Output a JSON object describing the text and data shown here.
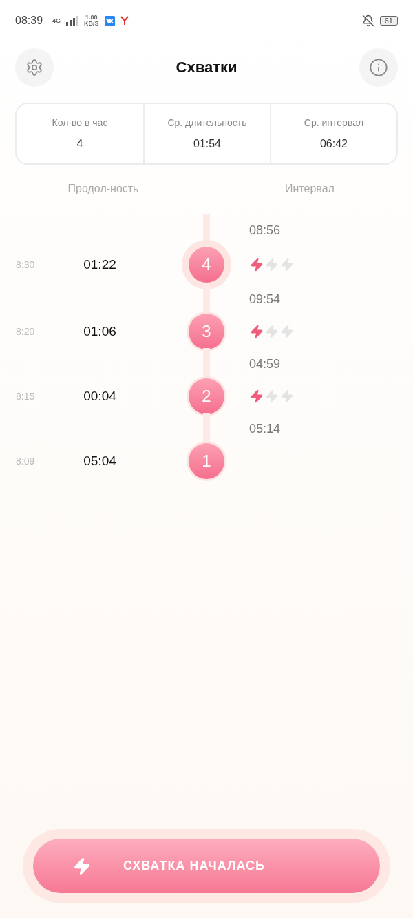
{
  "status_bar": {
    "time": "08:39",
    "network": "4G",
    "speed_value": "1.00",
    "speed_unit": "KB/S",
    "battery": "61"
  },
  "header": {
    "title": "Схватки"
  },
  "stats": [
    {
      "label": "Кол-во в час",
      "value": "4"
    },
    {
      "label": "Ср. длительность",
      "value": "01:54"
    },
    {
      "label": "Ср. интервал",
      "value": "06:42"
    }
  ],
  "columns": {
    "duration": "Продол-ность",
    "interval": "Интервал"
  },
  "contractions": [
    {
      "interval": "08:56",
      "time": "8:30",
      "duration": "01:22",
      "number": "4",
      "stars": 1,
      "selected": true
    },
    {
      "interval": "09:54",
      "time": "8:20",
      "duration": "01:06",
      "number": "3",
      "stars": 1,
      "selected": false
    },
    {
      "interval": "04:59",
      "time": "8:15",
      "duration": "00:04",
      "number": "2",
      "stars": 1,
      "selected": false
    },
    {
      "interval": "05:14",
      "time": "8:09",
      "duration": "05:04",
      "number": "1",
      "selected": false
    }
  ],
  "start_button": {
    "label": "СХВАТКА НАЧАЛАСЬ"
  }
}
